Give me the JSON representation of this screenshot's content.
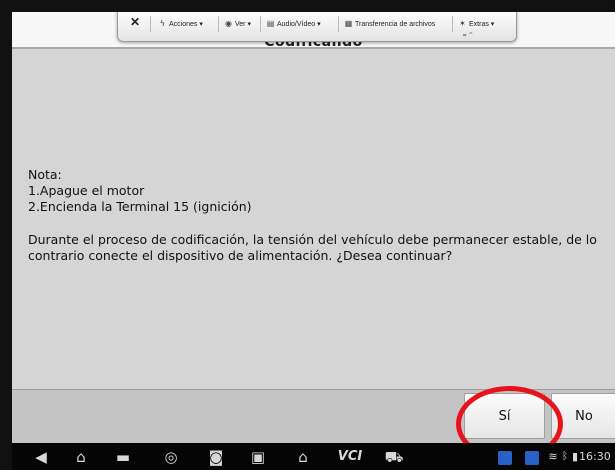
{
  "window": {
    "title": "Codificando"
  },
  "remote_toolbar": {
    "close": "✕",
    "items": [
      "Acciones ▾",
      "Ver ▾",
      "Audio/Vídeo ▾",
      "Transferencia de archivos",
      "Extras ▾"
    ],
    "minimize": "⌗ ^"
  },
  "dialog": {
    "note_heading": "Nota:",
    "note_lines": [
      "1.Apague el motor",
      "2.Encienda la Terminal 15 (ignición)"
    ],
    "body": "Durante el proceso de codificación, la tensión del vehículo debe permanecer estable, de lo contrario conecte el dispositivo de alimentación. ¿Desea continuar?",
    "buttons": {
      "yes": "Sí",
      "no": "No"
    }
  },
  "nav_bar": {
    "vci_label": "VCI",
    "clock": "16:30"
  },
  "colors": {
    "highlight": "#e8121a",
    "content_bg": "#d5d5d5",
    "nav_bg": "#050505"
  }
}
